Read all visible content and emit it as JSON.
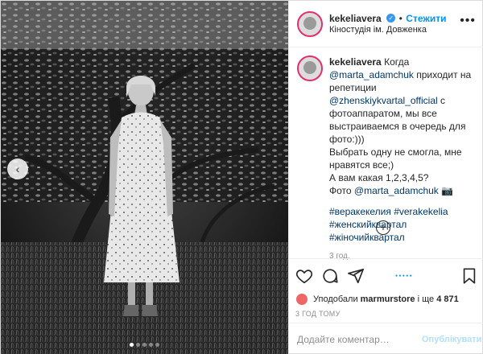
{
  "post": {
    "author": "kekeliavera",
    "follow_label": "Стежити",
    "location": "Кіностудія ім. Довженка",
    "more_glyph": "•••",
    "verified_glyph": "✓",
    "caption": {
      "author": "kekeliavera",
      "line1": "Когда",
      "mention1": "@marta_adamchuk",
      "line2": " приходит на",
      "line3": "репетиции ",
      "mention2": "@zhenskiykvartal_official",
      "line3b": " с",
      "line4": "фотоаппаратом, мы все",
      "line5": "выстраиваемся в очередь для",
      "line6": "фото:)))",
      "line7": "Выбрать одну не смогла, мне",
      "line8": "нравятся все;)",
      "line9": "А вам какая 1,2,3,4,5?",
      "line10": "Фото ",
      "mention3": "@marta_adamchuk",
      "line10b": " 📷",
      "tags_line1a": "#веракекелия",
      "tags_line1b": "#verakekelia",
      "tags_line2a": "#женскийквартал",
      "tags_line2b": "#жіночийквартал"
    },
    "caption_time": "3 год.",
    "plus_glyph": "+",
    "likes_prefix": "Уподобали ",
    "likes_user": "marmurstore",
    "likes_suffix": " і ще ",
    "likes_count": "4 871",
    "posted_ago": "3 ГОД ТОМУ",
    "comment_placeholder": "Додайте коментар…",
    "publish_label": "Опублікувати",
    "carousel": {
      "count": 5,
      "active": 1
    },
    "prev_glyph": "‹",
    "next_glyph": "›"
  },
  "colors": {
    "accent": "#0095f6",
    "link": "#00376b",
    "publish_disabled": "#b2dffc"
  },
  "icons": [
    "heart-icon",
    "comment-icon",
    "share-icon",
    "bookmark-icon"
  ]
}
